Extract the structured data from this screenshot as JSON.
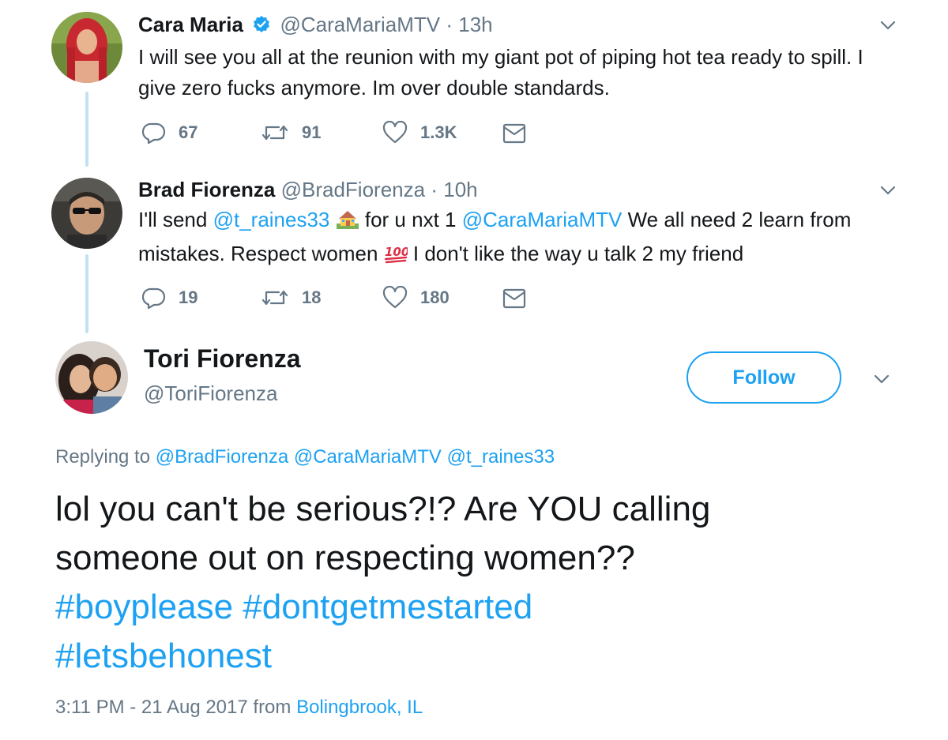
{
  "tweets": [
    {
      "name": "Cara Maria",
      "verified": true,
      "handle": "@CaraMariaMTV",
      "time": "13h",
      "text_line1": "I will see you all at the reunion with my giant pot of piping hot tea ready to spill. I",
      "text_line2": "give zero fucks anymore. Im over double standards.",
      "replies": "67",
      "retweets": "91",
      "likes": "1.3K"
    },
    {
      "name": "Brad Fiorenza",
      "handle": "@BradFiorenza",
      "time": "10h",
      "text_a": "I'll send ",
      "mention1": "@t_raines33",
      "text_b": " for u nxt 1 ",
      "mention2": "@CaraMariaMTV",
      "text_c": " We all need 2 learn from",
      "text_d": "mistakes. Respect women ",
      "text_e": " I don't like the way u talk 2 my friend",
      "emoji1": "house-with-garden-emoji",
      "emoji2": "hundred-points-emoji",
      "replies": "19",
      "retweets": "18",
      "likes": "180"
    }
  ],
  "main_tweet": {
    "name": "Tori Fiorenza",
    "handle": "@ToriFiorenza",
    "follow_label": "Follow",
    "replying_prefix": "Replying to ",
    "replying_to": [
      "@BradFiorenza",
      "@CaraMariaMTV",
      "@t_raines33"
    ],
    "line1": "lol you can't be serious?!? Are YOU calling",
    "line2": "someone out on respecting women??",
    "hashtags_line1": "#boyplease #dontgetmestarted",
    "hashtags_line2": "#letsbehonest",
    "timestamp": "3:11 PM - 21 Aug 2017 from ",
    "location": "Bolingbrook, IL"
  },
  "colors": {
    "link": "#1da1f2",
    "muted": "#657786",
    "thread_line": "#c4e0f3",
    "text": "#14171a"
  }
}
